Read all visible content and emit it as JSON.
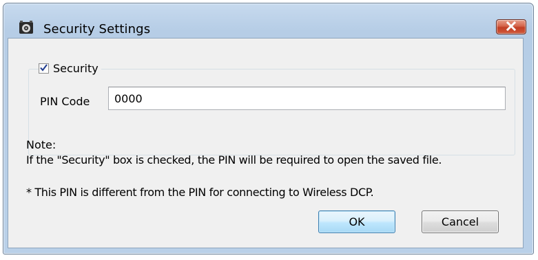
{
  "window": {
    "title": "Security Settings",
    "app_icon": "app-speaker-icon",
    "close_icon": "close-icon"
  },
  "security_group": {
    "checkbox_label": "Security",
    "checked": true
  },
  "pin": {
    "label": "PIN Code",
    "value": "0000",
    "placeholder": ""
  },
  "note": {
    "heading": "Note:",
    "line1": "If the \"Security\" box is checked, the PIN will be required to open the saved file.",
    "line2": "* This PIN is different from the PIN for connecting to Wireless DCP."
  },
  "buttons": {
    "ok_label": "OK",
    "cancel_label": "Cancel"
  },
  "colors": {
    "titlebar": "#b9d0e8",
    "close_button": "#c23f24",
    "client_bg": "#f0f0f0",
    "ok_button": "#bee6fd"
  }
}
